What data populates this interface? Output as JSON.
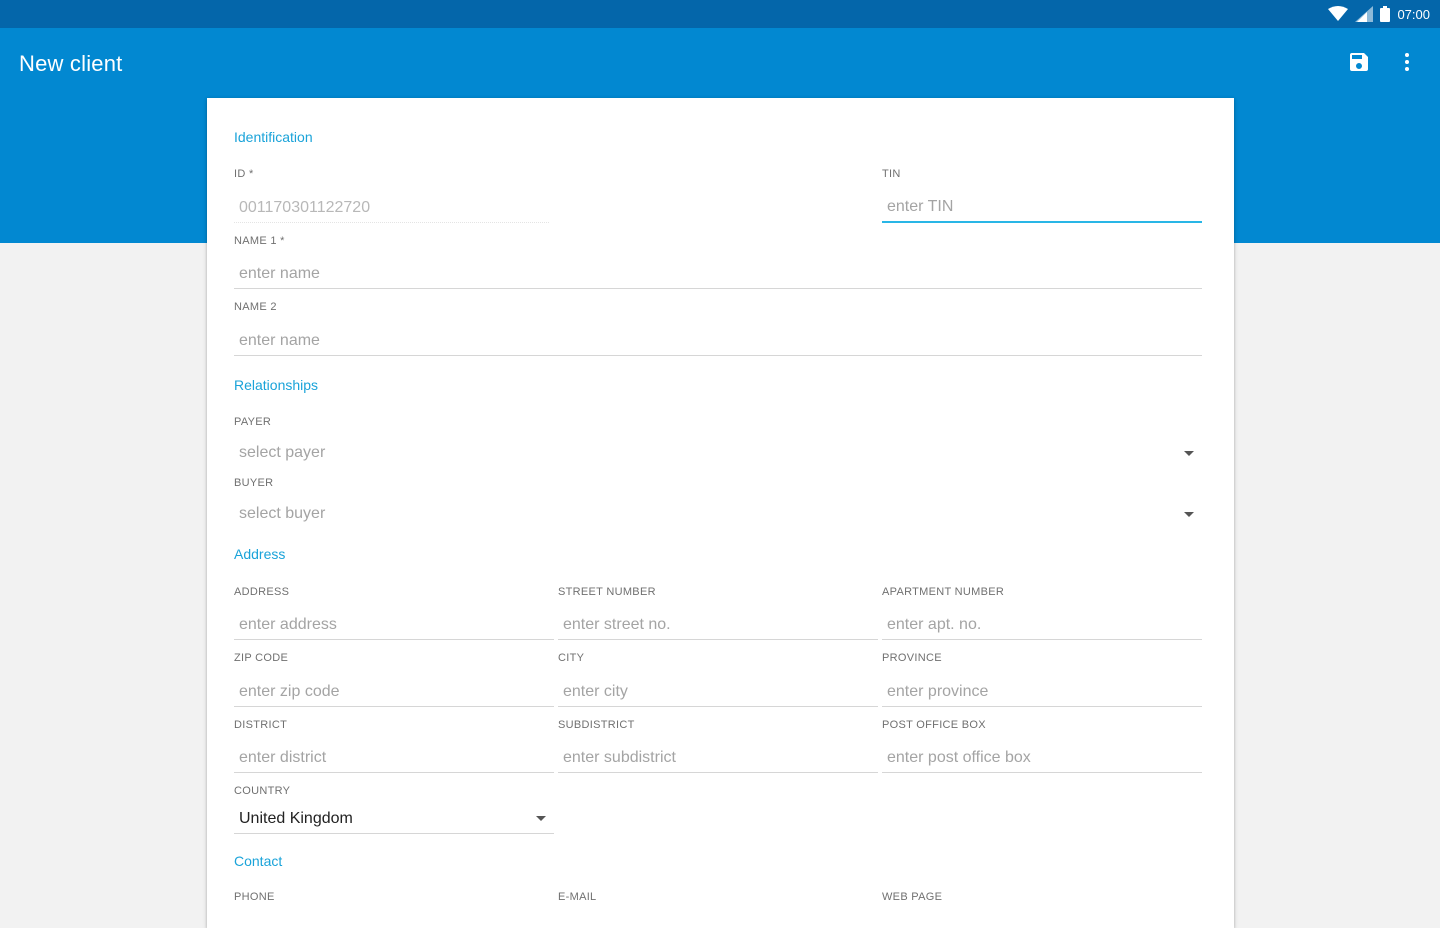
{
  "status_bar": {
    "time": "07:00",
    "icons": [
      "wifi-icon",
      "cell-signal-icon",
      "battery-icon"
    ]
  },
  "app_bar": {
    "title": "New client",
    "actions": [
      "save-icon",
      "more-vert-icon"
    ]
  },
  "colors": {
    "status_bar": "#0466aa",
    "app_bar": "#0288d1",
    "section_header": "#1aa3d9",
    "focus_underline": "#29b6e6"
  },
  "identification": {
    "header": "Identification",
    "id": {
      "label": "ID *",
      "value": "001170301122720"
    },
    "tin": {
      "label": "TIN",
      "placeholder": "enter TIN"
    },
    "name1": {
      "label": "NAME 1 *",
      "placeholder": "enter name"
    },
    "name2": {
      "label": "NAME 2",
      "placeholder": "enter name"
    }
  },
  "relationships": {
    "header": "Relationships",
    "payer": {
      "label": "PAYER",
      "placeholder": "select payer"
    },
    "buyer": {
      "label": "BUYER",
      "placeholder": "select buyer"
    }
  },
  "address": {
    "header": "Address",
    "address": {
      "label": "ADDRESS",
      "placeholder": "enter address"
    },
    "street_number": {
      "label": "STREET NUMBER",
      "placeholder": "enter street no."
    },
    "apartment_number": {
      "label": "APARTMENT NUMBER",
      "placeholder": "enter apt. no."
    },
    "zip_code": {
      "label": "ZIP CODE",
      "placeholder": "enter zip code"
    },
    "city": {
      "label": "CITY",
      "placeholder": "enter city"
    },
    "province": {
      "label": "PROVINCE",
      "placeholder": "enter province"
    },
    "district": {
      "label": "DISTRICT",
      "placeholder": "enter district"
    },
    "subdistrict": {
      "label": "SUBDISTRICT",
      "placeholder": "enter subdistrict"
    },
    "post_office_box": {
      "label": "POST OFFICE BOX",
      "placeholder": "enter post office box"
    },
    "country": {
      "label": "COUNTRY",
      "value": "United Kingdom"
    }
  },
  "contact": {
    "header": "Contact",
    "phone": {
      "label": "PHONE"
    },
    "email": {
      "label": "E-MAIL"
    },
    "web_page": {
      "label": "WEB PAGE"
    }
  }
}
